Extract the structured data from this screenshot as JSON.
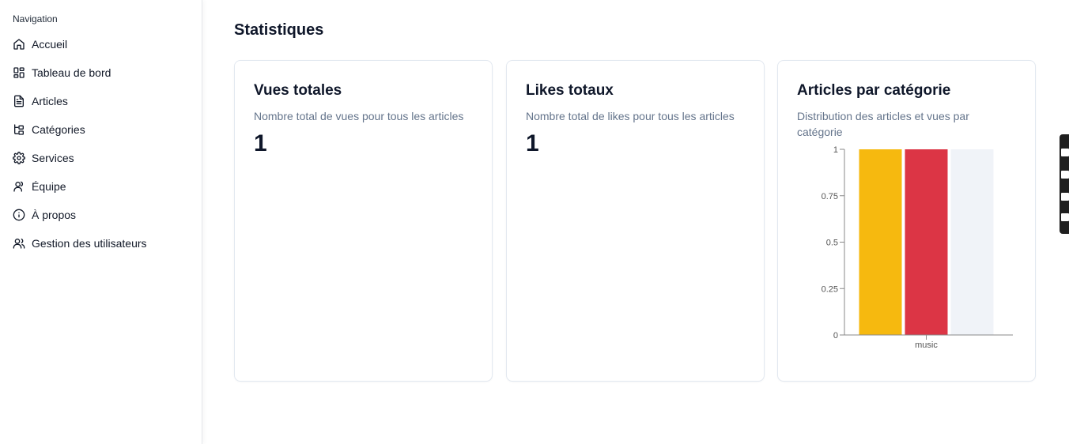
{
  "sidebar": {
    "heading": "Navigation",
    "items": [
      {
        "label": "Accueil",
        "icon": "home-icon"
      },
      {
        "label": "Tableau de bord",
        "icon": "dashboard-icon"
      },
      {
        "label": "Articles",
        "icon": "file-text-icon"
      },
      {
        "label": "Catégories",
        "icon": "tree-icon"
      },
      {
        "label": "Services",
        "icon": "gear-icon"
      },
      {
        "label": "Équipe",
        "icon": "user-icon"
      },
      {
        "label": "À propos",
        "icon": "info-icon"
      },
      {
        "label": "Gestion des utilisateurs",
        "icon": "users-icon"
      }
    ]
  },
  "main": {
    "title": "Statistiques",
    "cards": [
      {
        "title": "Vues totales",
        "description": "Nombre total de vues pour tous les articles",
        "value": "1"
      },
      {
        "title": "Likes totaux",
        "description": "Nombre total de likes pour tous les articles",
        "value": "1"
      },
      {
        "title": "Articles par catégorie",
        "description": "Distribution des articles et vues par catégorie"
      }
    ]
  },
  "chart_data": {
    "type": "bar",
    "categories": [
      "music"
    ],
    "series": [
      {
        "values": [
          1
        ],
        "color": "#f6b90f"
      },
      {
        "values": [
          1
        ],
        "color": "#dc3545"
      },
      {
        "values": [
          1
        ],
        "color": "#f0f3f8"
      }
    ],
    "ylim": [
      0,
      1
    ],
    "yticks": [
      "0",
      "0.25",
      "0.5",
      "0.75",
      "1"
    ],
    "ytick_values": [
      0,
      0.25,
      0.5,
      0.75,
      1
    ],
    "grid": false,
    "legend": "none"
  }
}
